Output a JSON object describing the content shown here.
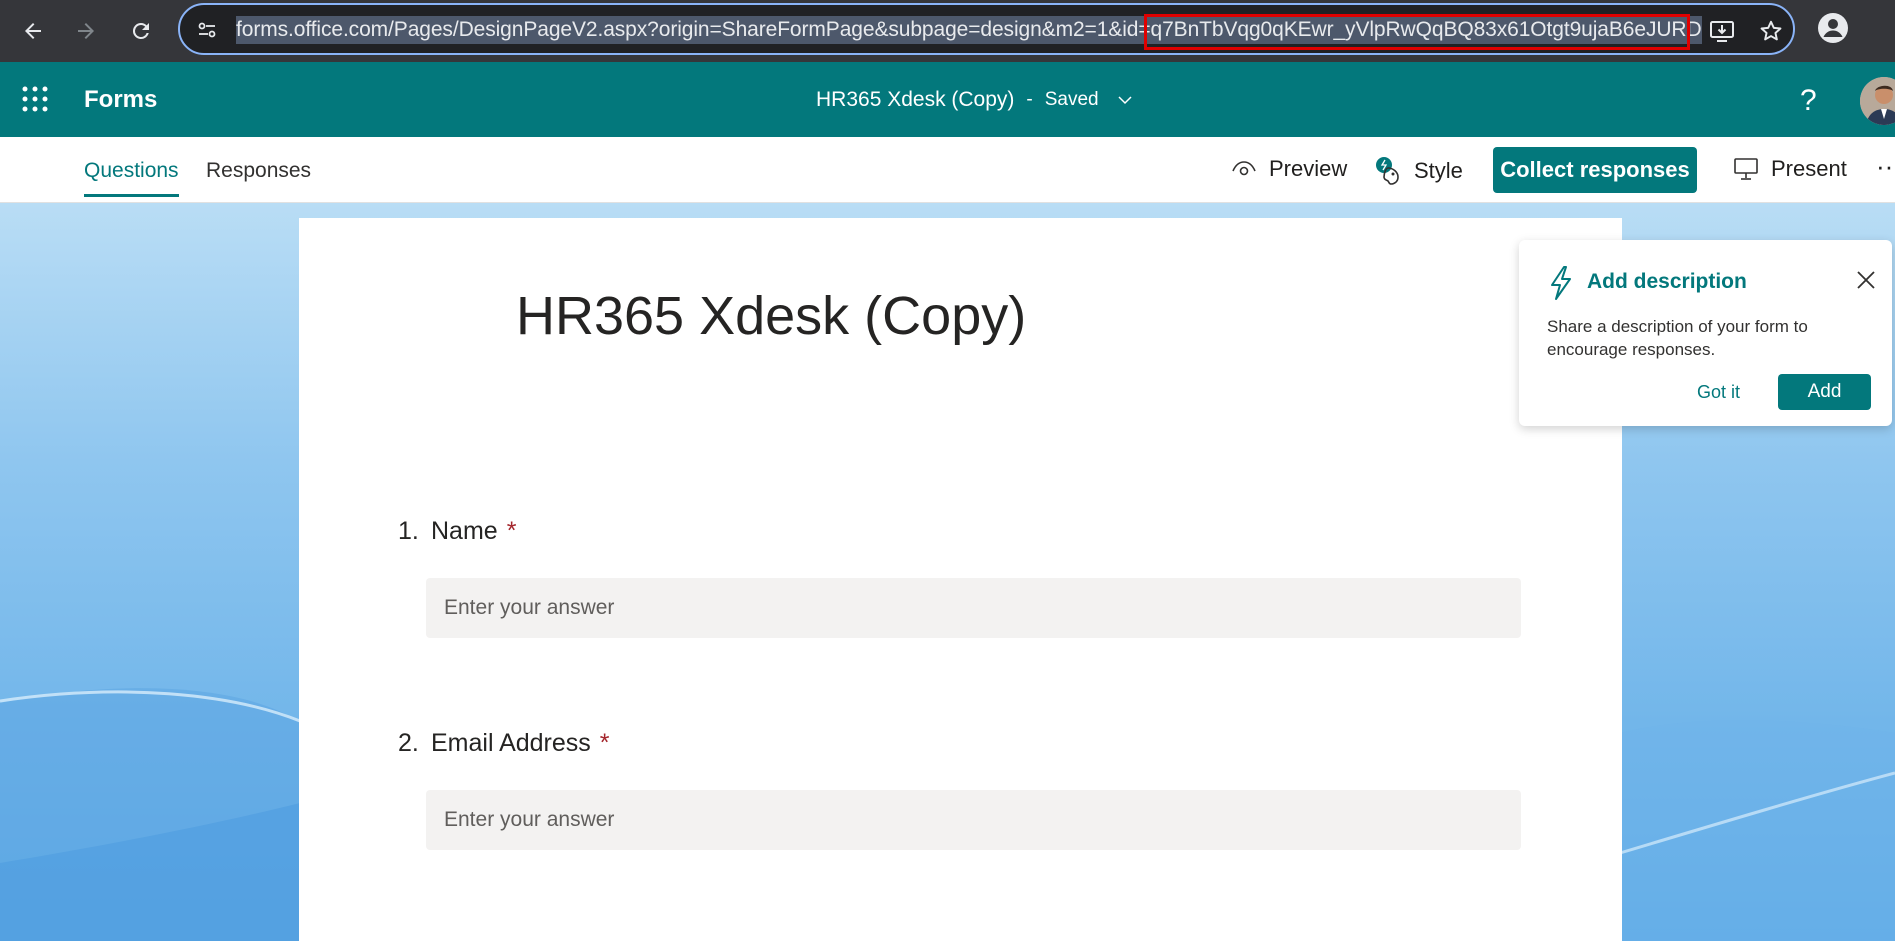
{
  "browser": {
    "url_prefix": "forms.office.com/Pages/DesignPageV2.aspx?origin=ShareFormPage&subpage=design&m2=1&id=",
    "url_highlighted": "q7BnTbVqg0qKEwr_yVlpRwQqBQ83x61Otgt9ujaB6eJURD"
  },
  "appbar": {
    "app_name": "Forms",
    "doc_title": "HR365 Xdesk (Copy)",
    "separator": "-",
    "status": "Saved",
    "help": "?"
  },
  "tabs": {
    "questions": "Questions",
    "responses": "Responses"
  },
  "toolbar": {
    "preview": "Preview",
    "style": "Style",
    "collect": "Collect responses",
    "present": "Present",
    "more": "···"
  },
  "form": {
    "title": "HR365 Xdesk (Copy)",
    "questions": [
      {
        "number": "1.",
        "label": "Name",
        "required_mark": "*",
        "placeholder": "Enter your answer"
      },
      {
        "number": "2.",
        "label": "Email Address",
        "required_mark": "*",
        "placeholder": "Enter your answer"
      }
    ]
  },
  "bubble": {
    "title": "Add description",
    "text": "Share a description of your form to encourage responses.",
    "got_it": "Got it",
    "add": "Add"
  },
  "colors": {
    "brand": "#03787c",
    "required": "#a4262c",
    "url_box": "#e00000"
  }
}
